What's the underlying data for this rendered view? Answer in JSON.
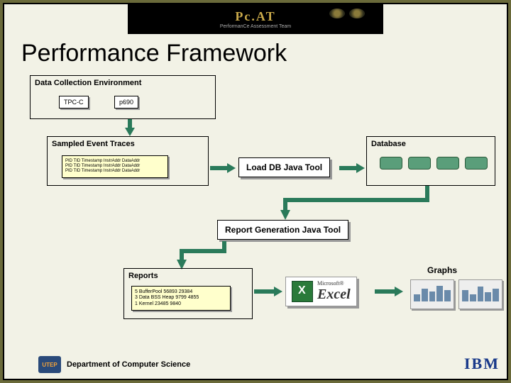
{
  "banner": {
    "logo_text": "Pc.AT",
    "subtitle": "PerformanCe Assessment Team"
  },
  "title": "Performance Framework",
  "data_collection": {
    "label": "Data Collection Environment",
    "boxes": [
      "TPC-C",
      "p690"
    ]
  },
  "sampled": {
    "label": "Sampled Event Traces",
    "lines": [
      "PID TID Timestamp InstrAddr DataAddr",
      "PID TID Timestamp InstrAddr DataAddr",
      "PID TID Timestamp InstrAddr DataAddr"
    ]
  },
  "database": {
    "label": "Database"
  },
  "load_tool": {
    "label": "Load DB Java Tool"
  },
  "report_gen": {
    "label": "Report Generation Java Tool"
  },
  "reports": {
    "label": "Reports",
    "lines": [
      "5 BufferPool 56893 29384",
      "3 Data BSS Heap 9799 4855",
      "1 Kernel 23485 9840"
    ]
  },
  "graphs": {
    "label": "Graphs"
  },
  "excel": {
    "ms": "Microsoft®",
    "name": "Excel"
  },
  "footer": {
    "dept": "Department of Computer Science",
    "utep": "UTEP",
    "ibm": "IBM"
  }
}
